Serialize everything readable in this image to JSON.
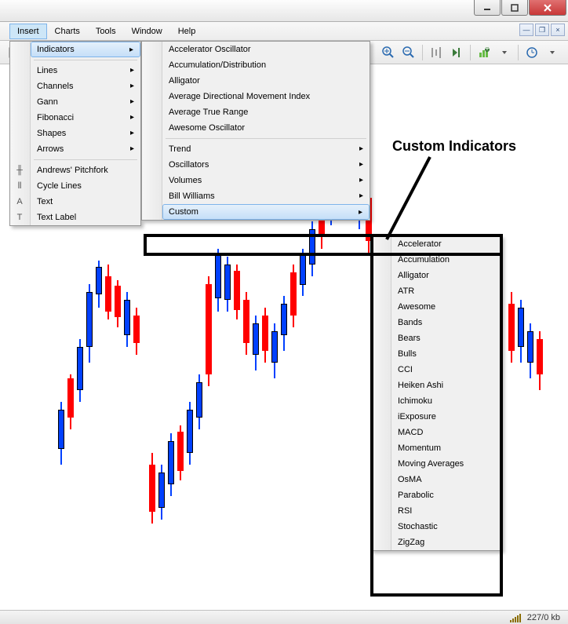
{
  "window": {
    "close": "x",
    "max": "▭",
    "min": "—"
  },
  "menubar": [
    "Insert",
    "Charts",
    "Tools",
    "Window",
    "Help"
  ],
  "insert_menu": {
    "indicators": "Indicators",
    "lines": "Lines",
    "channels": "Channels",
    "gann": "Gann",
    "fibonacci": "Fibonacci",
    "shapes": "Shapes",
    "arrows": "Arrows",
    "pitchfork": "Andrews' Pitchfork",
    "cycle": "Cycle Lines",
    "text": "Text",
    "textlabel": "Text Label"
  },
  "indicators_menu": {
    "accel": "Accelerator Oscillator",
    "accum": "Accumulation/Distribution",
    "alligator": "Alligator",
    "adx": "Average Directional Movement Index",
    "atr": "Average True Range",
    "awesome": "Awesome Oscillator",
    "trend": "Trend",
    "oscillators": "Oscillators",
    "volumes": "Volumes",
    "billwilliams": "Bill Williams",
    "custom": "Custom"
  },
  "custom_menu": [
    "Accelerator",
    "Accumulation",
    "Alligator",
    "ATR",
    "Awesome",
    "Bands",
    "Bears",
    "Bulls",
    "CCI",
    "Heiken Ashi",
    "Ichimoku",
    "iExposure",
    "MACD",
    "Momentum",
    "Moving Averages",
    "OsMA",
    "Parabolic",
    "RSI",
    "Stochastic",
    "ZigZag"
  ],
  "annotation": {
    "title": "Custom Indicators"
  },
  "status": {
    "kb": "227/0 kb"
  }
}
